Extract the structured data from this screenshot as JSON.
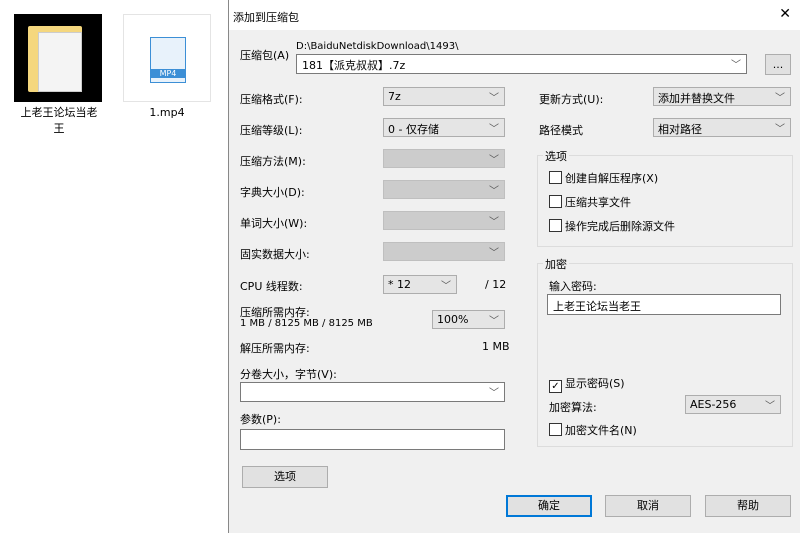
{
  "desktop": {
    "folder_label": "上老王论坛当老王",
    "video_label": "1.mp4",
    "video_badge": "MP4"
  },
  "dialog": {
    "title": "添加到压缩包",
    "close": "✕",
    "archive_label": "压缩包(A)",
    "archive_dir": "D:\\BaiduNetdiskDownload\\1493\\",
    "archive_name": "181【派克叔叔】.7z",
    "browse": "...",
    "format_label": "压缩格式(F):",
    "format_value": "7z",
    "level_label": "压缩等级(L):",
    "level_value": "0 - 仅存储",
    "method_label": "压缩方法(M):",
    "dict_label": "字典大小(D):",
    "word_label": "单词大小(W):",
    "solid_label": "固实数据大小:",
    "cpu_label": "CPU 线程数:",
    "cpu_value": "* 12",
    "cpu_max": "/ 12",
    "mem_comp_label": "压缩所需内存:",
    "mem_comp_value": "1 MB / 8125 MB / 8125 MB",
    "mem_percent": "100%",
    "mem_decomp_label": "解压所需内存:",
    "mem_decomp_value": "1 MB",
    "split_label": "分卷大小，字节(V):",
    "split_value": "",
    "params_label": "参数(P):",
    "params_value": "",
    "options_button": "选项",
    "update_label": "更新方式(U):",
    "update_value": "添加并替换文件",
    "path_label": "路径模式",
    "path_value": "相对路径",
    "options_group": "选项",
    "opt_sfx": "创建自解压程序(X)",
    "opt_shared": "压缩共享文件",
    "opt_delete": "操作完成后删除源文件",
    "enc_group": "加密",
    "password_label": "输入密码:",
    "password_value": "上老王论坛当老王",
    "show_password": "显示密码(S)",
    "enc_method_label": "加密算法:",
    "enc_method_value": "AES-256",
    "enc_names": "加密文件名(N)",
    "ok": "确定",
    "cancel": "取消",
    "help": "帮助"
  }
}
